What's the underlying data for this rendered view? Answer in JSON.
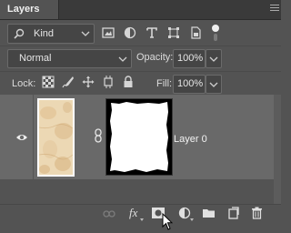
{
  "panel": {
    "tab_label": "Layers"
  },
  "filter": {
    "kind_label": "Kind",
    "icons": [
      "search-icon",
      "image-filter-icon",
      "adjustment-filter-icon",
      "type-filter-icon",
      "shape-filter-icon",
      "smart-object-filter-icon",
      "filter-toggle-icon"
    ]
  },
  "blend": {
    "mode": "Normal",
    "opacity_label": "Opacity:",
    "opacity_value": "100%"
  },
  "lock": {
    "label": "Lock:",
    "icons": [
      "lock-transparent-icon",
      "lock-image-icon",
      "lock-position-icon",
      "lock-artboard-icon",
      "lock-all-icon"
    ],
    "fill_label": "Fill:",
    "fill_value": "100%"
  },
  "layers": [
    {
      "name": "Layer 0",
      "visible": true,
      "has_mask": true
    }
  ],
  "bottom_icons": [
    "link-layers-icon",
    "fx-icon",
    "add-mask-icon",
    "adjustment-layer-icon",
    "new-group-icon",
    "new-layer-icon",
    "delete-icon"
  ],
  "bottom": {
    "fx_label": "fx"
  },
  "colors": {
    "panel_bg": "#535353",
    "selected_row": "#696969",
    "tab_bar": "#3a3a3a",
    "text": "#dcdcdc"
  }
}
